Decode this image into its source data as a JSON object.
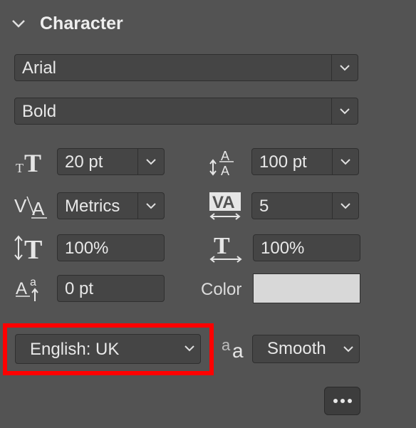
{
  "panel": {
    "title": "Character",
    "collapse_icon": "chevron-down-icon"
  },
  "font": {
    "family": "Arial",
    "style": "Bold"
  },
  "size": {
    "value": "20 pt",
    "icon": "font-size-icon"
  },
  "leading": {
    "value": "100 pt",
    "icon": "leading-icon"
  },
  "kerning": {
    "value": "Metrics",
    "icon": "kerning-icon"
  },
  "tracking": {
    "value": "5",
    "icon": "tracking-icon"
  },
  "vertical_scale": {
    "value": "100%",
    "icon": "vertical-scale-icon"
  },
  "horizontal_scale": {
    "value": "100%",
    "icon": "horizontal-scale-icon"
  },
  "baseline_shift": {
    "value": "0 pt",
    "icon": "baseline-shift-icon"
  },
  "color": {
    "label": "Color",
    "swatch": "#d8d8d8"
  },
  "language": {
    "value": "English: UK",
    "highlight_color": "#ff0000"
  },
  "antialias": {
    "value": "Smooth",
    "icon": "antialias-icon",
    "icon_text": "a"
  },
  "more_button": {
    "icon": "more-icon"
  }
}
